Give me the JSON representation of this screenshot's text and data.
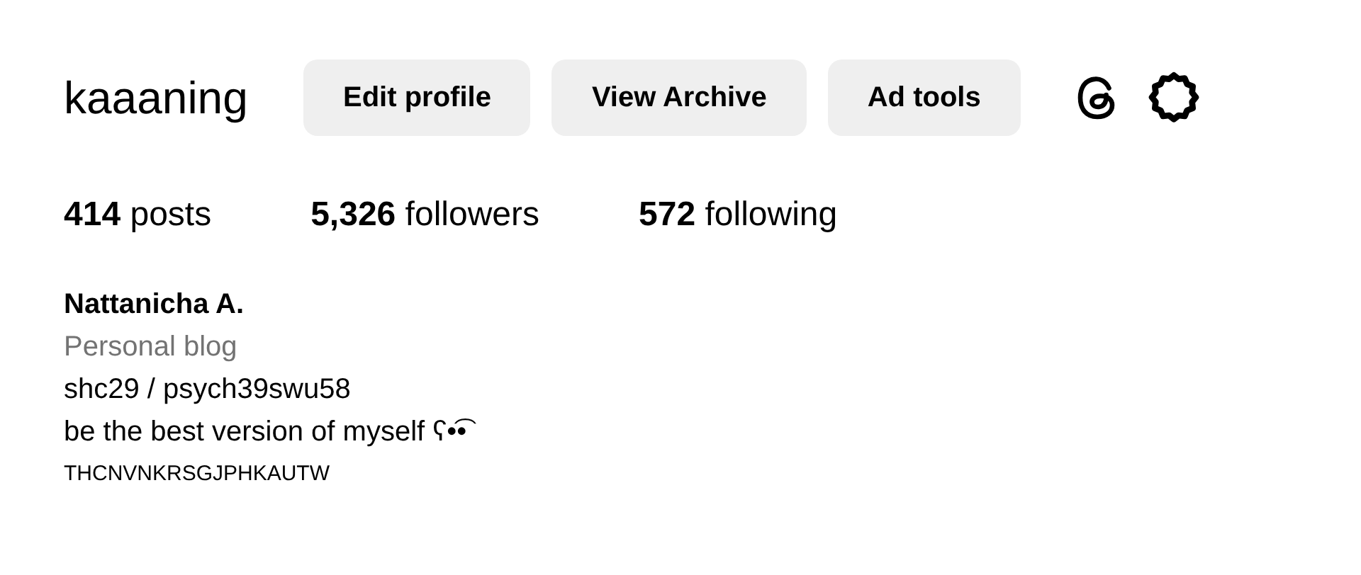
{
  "profile": {
    "username": "kaaaning",
    "buttons": [
      {
        "label": "Edit profile"
      },
      {
        "label": "View Archive"
      },
      {
        "label": "Ad tools"
      }
    ],
    "stats": [
      {
        "count": "414",
        "label": "posts"
      },
      {
        "count": "5,326",
        "label": "followers"
      },
      {
        "count": "572",
        "label": "following"
      }
    ],
    "name": "Nattanicha A.",
    "category": "Personal blog",
    "bio": [
      "shc29 / psych39swu58",
      "be the best version of myself ʕ•͡•"
    ],
    "tag": "THCNVNKRSGJPHKAUTW"
  }
}
